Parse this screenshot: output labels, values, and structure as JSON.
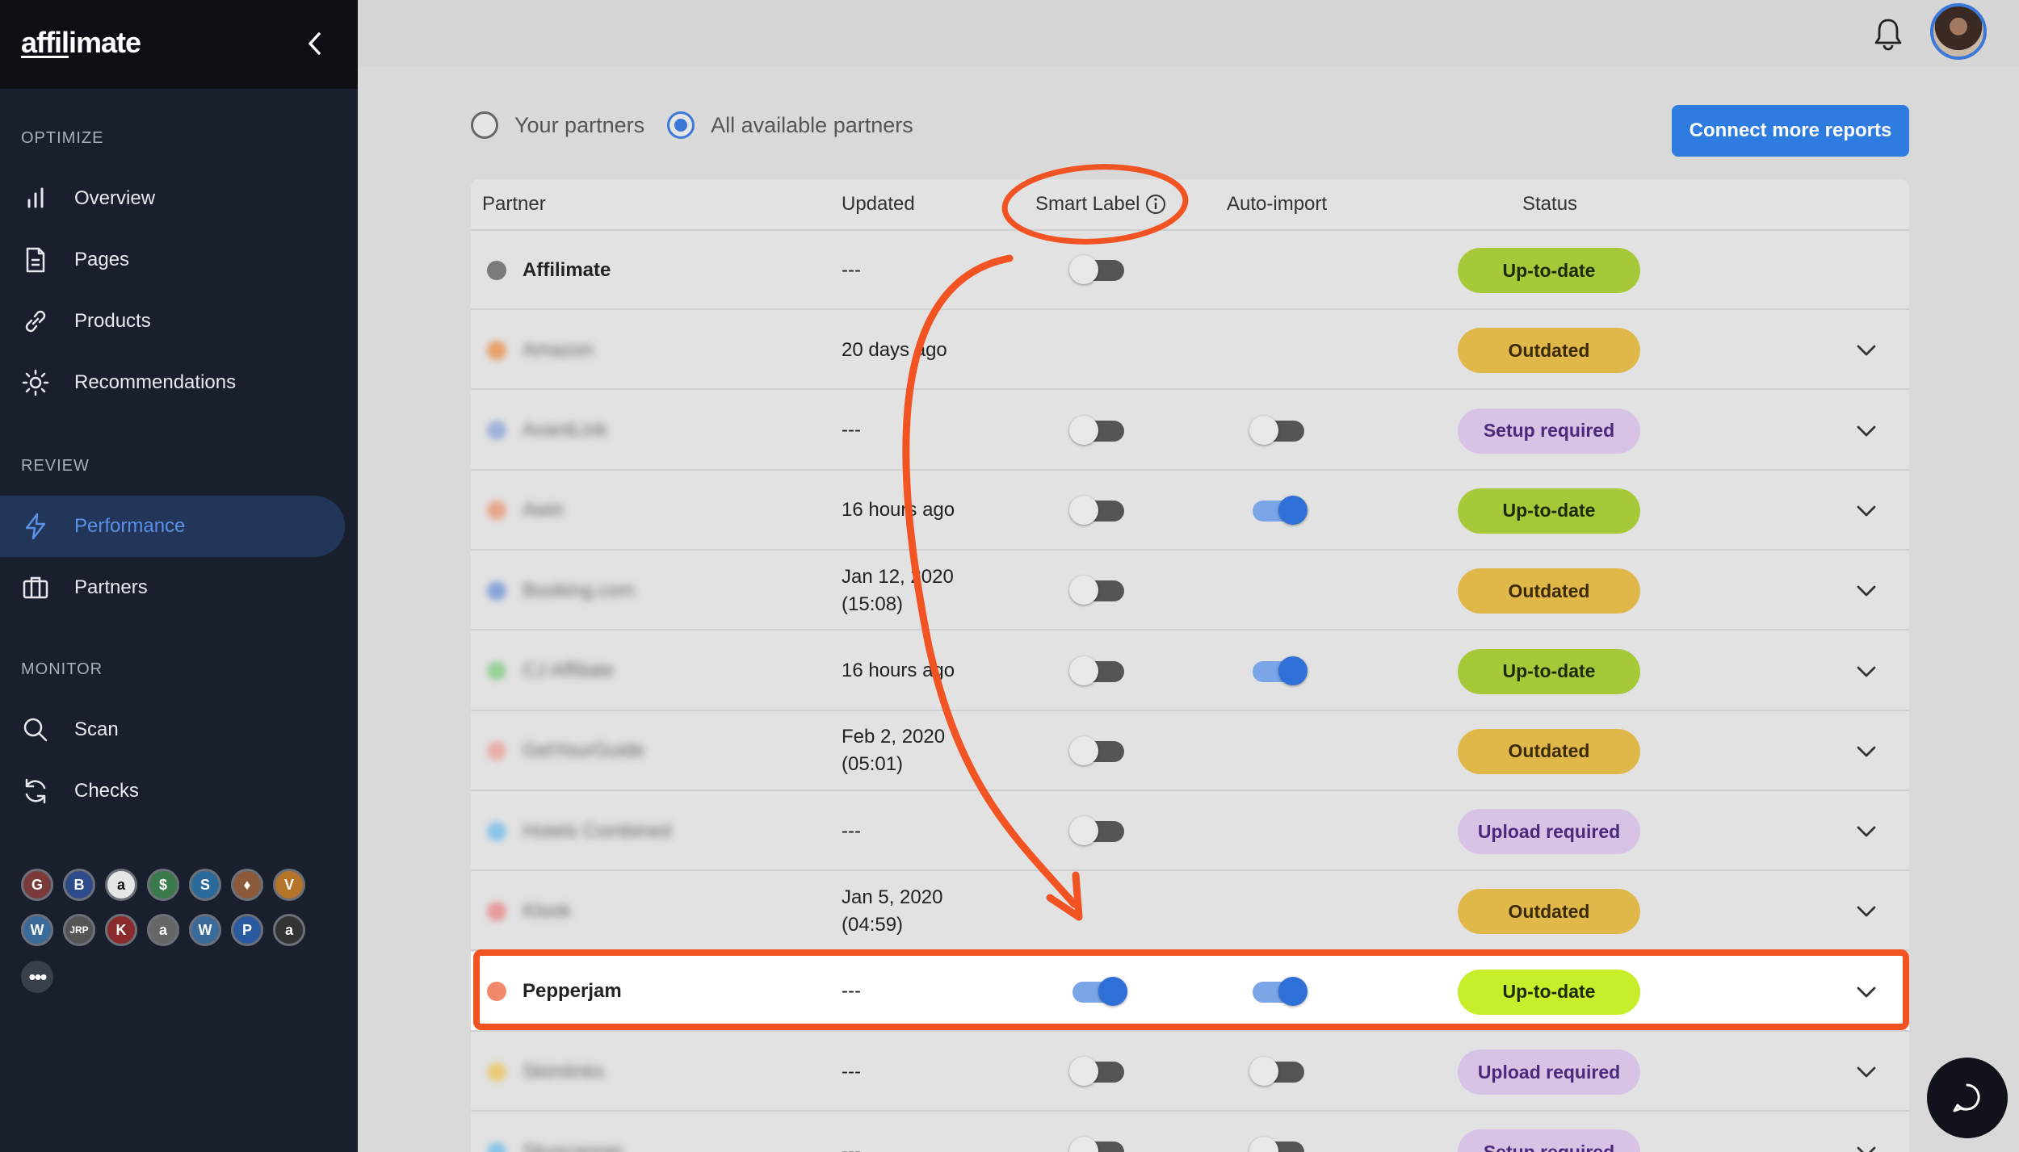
{
  "app": {
    "logo_prefix": "affil",
    "logo_suffix": "imate"
  },
  "sidebar": {
    "sections": {
      "optimize": "OPTIMIZE",
      "review": "REVIEW",
      "monitor": "MONITOR"
    },
    "items": [
      {
        "label": "Overview",
        "icon": "bar-chart-icon"
      },
      {
        "label": "Pages",
        "icon": "document-icon"
      },
      {
        "label": "Products",
        "icon": "link-icon"
      },
      {
        "label": "Recommendations",
        "icon": "sun-icon"
      },
      {
        "label": "Performance",
        "icon": "bolt-icon",
        "active": true
      },
      {
        "label": "Partners",
        "icon": "briefcase-icon"
      },
      {
        "label": "Scan",
        "icon": "search-icon"
      },
      {
        "label": "Checks",
        "icon": "refresh-icon"
      }
    ],
    "partner_logos": [
      "G",
      "B",
      "a",
      "$",
      "S",
      "♦",
      "V",
      "W",
      "JRP",
      "K",
      "a",
      "W",
      "P",
      "a"
    ],
    "more": "•••"
  },
  "filters": {
    "your_partners": "Your partners",
    "all_partners": "All available partners",
    "selected": "all"
  },
  "connect_button": "Connect more reports",
  "table": {
    "headers": {
      "partner": "Partner",
      "updated": "Updated",
      "smart_label": "Smart Label",
      "auto_import": "Auto-import",
      "status": "Status"
    },
    "rows": [
      {
        "partner": "Affilimate",
        "blurred": false,
        "updated": "---",
        "smart": "off",
        "auto": "",
        "status": "Up-to-date",
        "chevron": false
      },
      {
        "partner": "Amazon",
        "blurred": true,
        "updated": "20 days ago",
        "smart": "",
        "auto": "",
        "status": "Outdated",
        "chevron": true
      },
      {
        "partner": "AvantLink",
        "blurred": true,
        "updated": "---",
        "smart": "off",
        "auto": "off",
        "status": "Setup required",
        "chevron": true
      },
      {
        "partner": "Awin",
        "blurred": true,
        "updated": "16 hours ago",
        "smart": "off",
        "auto": "on",
        "status": "Up-to-date",
        "chevron": true
      },
      {
        "partner": "Booking.com",
        "blurred": true,
        "updated": "Jan 12, 2020\n(15:08)",
        "smart": "off",
        "auto": "",
        "status": "Outdated",
        "chevron": true
      },
      {
        "partner": "CJ Affiliate",
        "blurred": true,
        "updated": "16 hours ago",
        "smart": "off",
        "auto": "on",
        "status": "Up-to-date",
        "chevron": true
      },
      {
        "partner": "GetYourGuide",
        "blurred": true,
        "updated": "Feb 2, 2020\n(05:01)",
        "smart": "off",
        "auto": "",
        "status": "Outdated",
        "chevron": true
      },
      {
        "partner": "Hotels Combined",
        "blurred": true,
        "updated": "---",
        "smart": "off",
        "auto": "",
        "status": "Upload required",
        "chevron": true
      },
      {
        "partner": "Klook",
        "blurred": true,
        "updated": "Jan 5, 2020\n(04:59)",
        "smart": "",
        "auto": "",
        "status": "Outdated",
        "chevron": true
      },
      {
        "partner": "Pepperjam",
        "blurred": false,
        "highlight": true,
        "updated": "---",
        "smart": "on",
        "auto": "on",
        "status": "Up-to-date",
        "chevron": true
      },
      {
        "partner": "Skimlinks",
        "blurred": true,
        "updated": "---",
        "smart": "off",
        "auto": "off",
        "status": "Upload required",
        "chevron": true
      },
      {
        "partner": "Skyscanner",
        "blurred": true,
        "updated": "---",
        "smart": "off",
        "auto": "off",
        "status": "Setup required",
        "chevron": true
      }
    ]
  },
  "status_colors": {
    "Up-to-date": {
      "bg": "#a6c93a",
      "fg": "#1e2a05"
    },
    "Outdated": {
      "bg": "#e0b84a",
      "fg": "#3a2a05"
    },
    "Setup required": {
      "bg": "#d8c3e6",
      "fg": "#4a2a7a"
    },
    "Upload required": {
      "bg": "#d8c3e6",
      "fg": "#4a2a7a"
    },
    "highlight_up": {
      "bg": "#c6ee2a",
      "fg": "#1e2a05"
    }
  },
  "icon_colors": [
    "#7a7a7a",
    "#e9a06a",
    "#9fb2d8",
    "#e8a68e",
    "#8aa4d8",
    "#9ad09a",
    "#e8b0a8",
    "#8ac4e8",
    "#e89a9a",
    "#f08a6a",
    "#e8cc7a",
    "#8ac4e8"
  ],
  "accent": "#3b78d8",
  "annotation_color": "#f25322"
}
